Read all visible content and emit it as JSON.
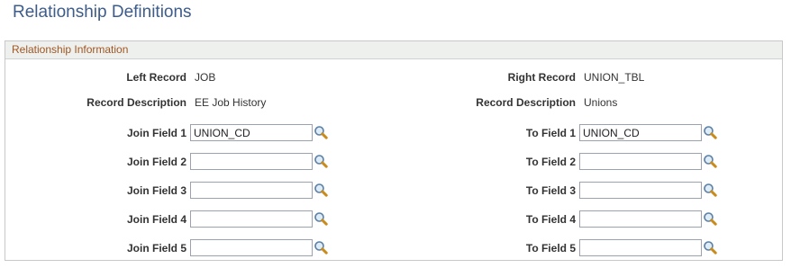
{
  "page": {
    "title": "Relationship Definitions"
  },
  "group": {
    "header": "Relationship Information"
  },
  "left": {
    "record_label": "Left Record",
    "record_value": "JOB",
    "desc_label": "Record Description",
    "desc_value": "EE Job History",
    "join_fields": [
      {
        "label": "Join Field 1",
        "value": "UNION_CD"
      },
      {
        "label": "Join Field 2",
        "value": ""
      },
      {
        "label": "Join Field 3",
        "value": ""
      },
      {
        "label": "Join Field 4",
        "value": ""
      },
      {
        "label": "Join Field 5",
        "value": ""
      }
    ]
  },
  "right": {
    "record_label": "Right Record",
    "record_value": "UNION_TBL",
    "desc_label": "Record Description",
    "desc_value": "Unions",
    "to_fields": [
      {
        "label": "To Field 1",
        "value": "UNION_CD"
      },
      {
        "label": "To Field 2",
        "value": ""
      },
      {
        "label": "To Field 3",
        "value": ""
      },
      {
        "label": "To Field 4",
        "value": ""
      },
      {
        "label": "To Field 5",
        "value": ""
      }
    ]
  },
  "icons": {
    "lookup": "magnifier-lookup-icon"
  },
  "colors": {
    "title": "#3d5c8a",
    "group_header_text": "#a05620",
    "group_header_bg": "#eef0ee",
    "field_border": "#9aa3ad"
  }
}
